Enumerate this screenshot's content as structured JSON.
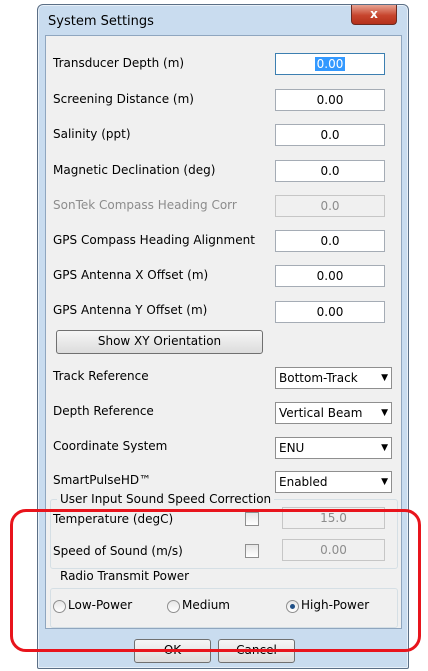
{
  "window": {
    "title": "System Settings",
    "close_label": "x"
  },
  "fields": [
    {
      "label": "Transducer Depth (m)",
      "value": "0.00"
    },
    {
      "label": "Screening Distance (m)",
      "value": "0.00"
    },
    {
      "label": "Salinity (ppt)",
      "value": "0.0"
    },
    {
      "label": "Magnetic Declination (deg)",
      "value": "0.0"
    },
    {
      "label": "SonTek Compass Heading Corr",
      "value": "0.0"
    },
    {
      "label": "GPS Compass Heading Alignment",
      "value": "0.0"
    },
    {
      "label": "GPS Antenna X Offset (m)",
      "value": "0.00"
    },
    {
      "label": "GPS Antenna Y Offset (m)",
      "value": "0.00"
    }
  ],
  "show_xy_button": "Show XY Orientation",
  "dropdowns": [
    {
      "label": "Track Reference",
      "value": "Bottom-Track"
    },
    {
      "label": "Depth Reference",
      "value": "Vertical Beam"
    },
    {
      "label": "Coordinate System",
      "value": "ENU"
    },
    {
      "label": "SmartPulseHD™",
      "value": "Enabled"
    }
  ],
  "sound_speed": {
    "title": "User Input Sound Speed Correction",
    "temperature_label": "Temperature (degC)",
    "temperature_value": "15.0",
    "speed_label": "Speed of Sound (m/s)",
    "speed_value": "0.00"
  },
  "radio_power": {
    "title": "Radio Transmit Power",
    "options": [
      "Low-Power",
      "Medium",
      "High-Power"
    ],
    "selected": "High-Power"
  },
  "buttons": {
    "ok": "OK",
    "cancel": "Cancel"
  },
  "colors": {
    "frame": "#c9dcef",
    "highlight": "#e8141c",
    "selection": "#3399ff"
  }
}
